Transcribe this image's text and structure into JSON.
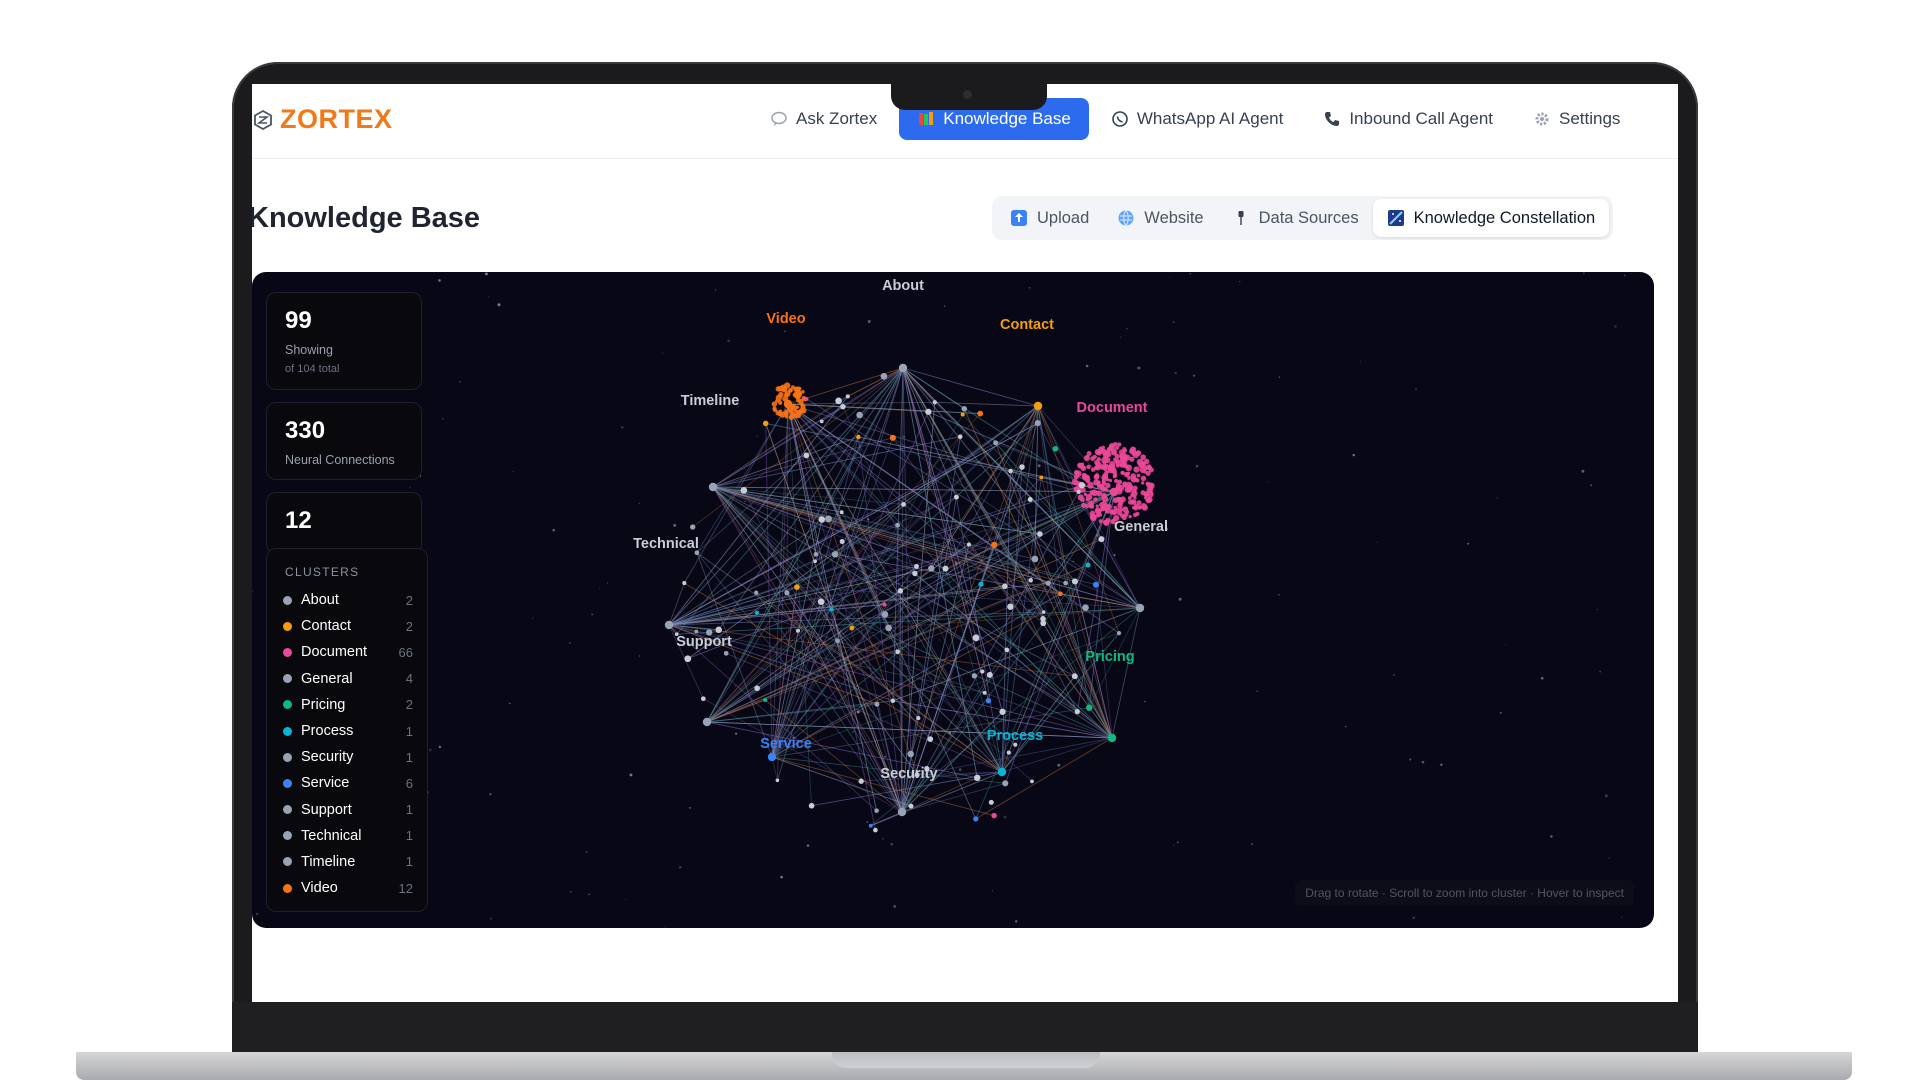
{
  "app": {
    "brand": "ZORTEX",
    "colors": {
      "brand": "#f07a1a",
      "accent": "#2c6bed",
      "panel_bg": "#070716"
    }
  },
  "nav": {
    "items": [
      {
        "label": "Ask Zortex",
        "icon": "chat-bubble-icon",
        "active": false
      },
      {
        "label": "Knowledge Base",
        "icon": "books-icon",
        "active": true
      },
      {
        "label": "WhatsApp AI Agent",
        "icon": "whatsapp-icon",
        "active": false
      },
      {
        "label": "Inbound Call Agent",
        "icon": "phone-icon",
        "active": false
      },
      {
        "label": "Settings",
        "icon": "gear-icon",
        "active": false
      }
    ]
  },
  "page": {
    "title": "Knowledge Base",
    "tabs": [
      {
        "label": "Upload",
        "icon": "upload-icon",
        "active": false
      },
      {
        "label": "Website",
        "icon": "globe-icon",
        "active": false
      },
      {
        "label": "Data Sources",
        "icon": "pin-icon",
        "active": false
      },
      {
        "label": "Knowledge Constellation",
        "icon": "constellation-icon",
        "active": true
      }
    ]
  },
  "stats": {
    "showing_value": "99",
    "showing_label": "Showing",
    "showing_sub": "of 104 total",
    "connections_value": "330",
    "connections_label": "Neural Connections",
    "clusters_value": "12"
  },
  "clusters": {
    "title": "CLUSTERS",
    "items": [
      {
        "name": "About",
        "count": "2",
        "color": "#9aa3b5"
      },
      {
        "name": "Contact",
        "count": "2",
        "color": "#f59e0b"
      },
      {
        "name": "Document",
        "count": "66",
        "color": "#ec4899"
      },
      {
        "name": "General",
        "count": "4",
        "color": "#9aa3b5"
      },
      {
        "name": "Pricing",
        "count": "2",
        "color": "#10b981"
      },
      {
        "name": "Process",
        "count": "1",
        "color": "#06b6d4"
      },
      {
        "name": "Security",
        "count": "1",
        "color": "#9aa3b5"
      },
      {
        "name": "Service",
        "count": "6",
        "color": "#3b82f6"
      },
      {
        "name": "Support",
        "count": "1",
        "color": "#9aa3b5"
      },
      {
        "name": "Technical",
        "count": "1",
        "color": "#9aa3b5"
      },
      {
        "name": "Timeline",
        "count": "1",
        "color": "#9aa3b5"
      },
      {
        "name": "Video",
        "count": "12",
        "color": "#f97316"
      }
    ]
  },
  "graph_labels": [
    {
      "text": "About",
      "color": "#c9cdd6"
    },
    {
      "text": "Video",
      "color": "#f97316"
    },
    {
      "text": "Contact",
      "color": "#f59e0b"
    },
    {
      "text": "Timeline",
      "color": "#c9cdd6"
    },
    {
      "text": "Document",
      "color": "#ec4899"
    },
    {
      "text": "General",
      "color": "#c9cdd6"
    },
    {
      "text": "Technical",
      "color": "#c9cdd6"
    },
    {
      "text": "Support",
      "color": "#c9cdd6"
    },
    {
      "text": "Pricing",
      "color": "#10b981"
    },
    {
      "text": "Service",
      "color": "#3b82f6"
    },
    {
      "text": "Process",
      "color": "#06b6d4"
    },
    {
      "text": "Security",
      "color": "#c9cdd6"
    }
  ],
  "hint": "Drag to rotate · Scroll to zoom into cluster · Hover to inspect"
}
